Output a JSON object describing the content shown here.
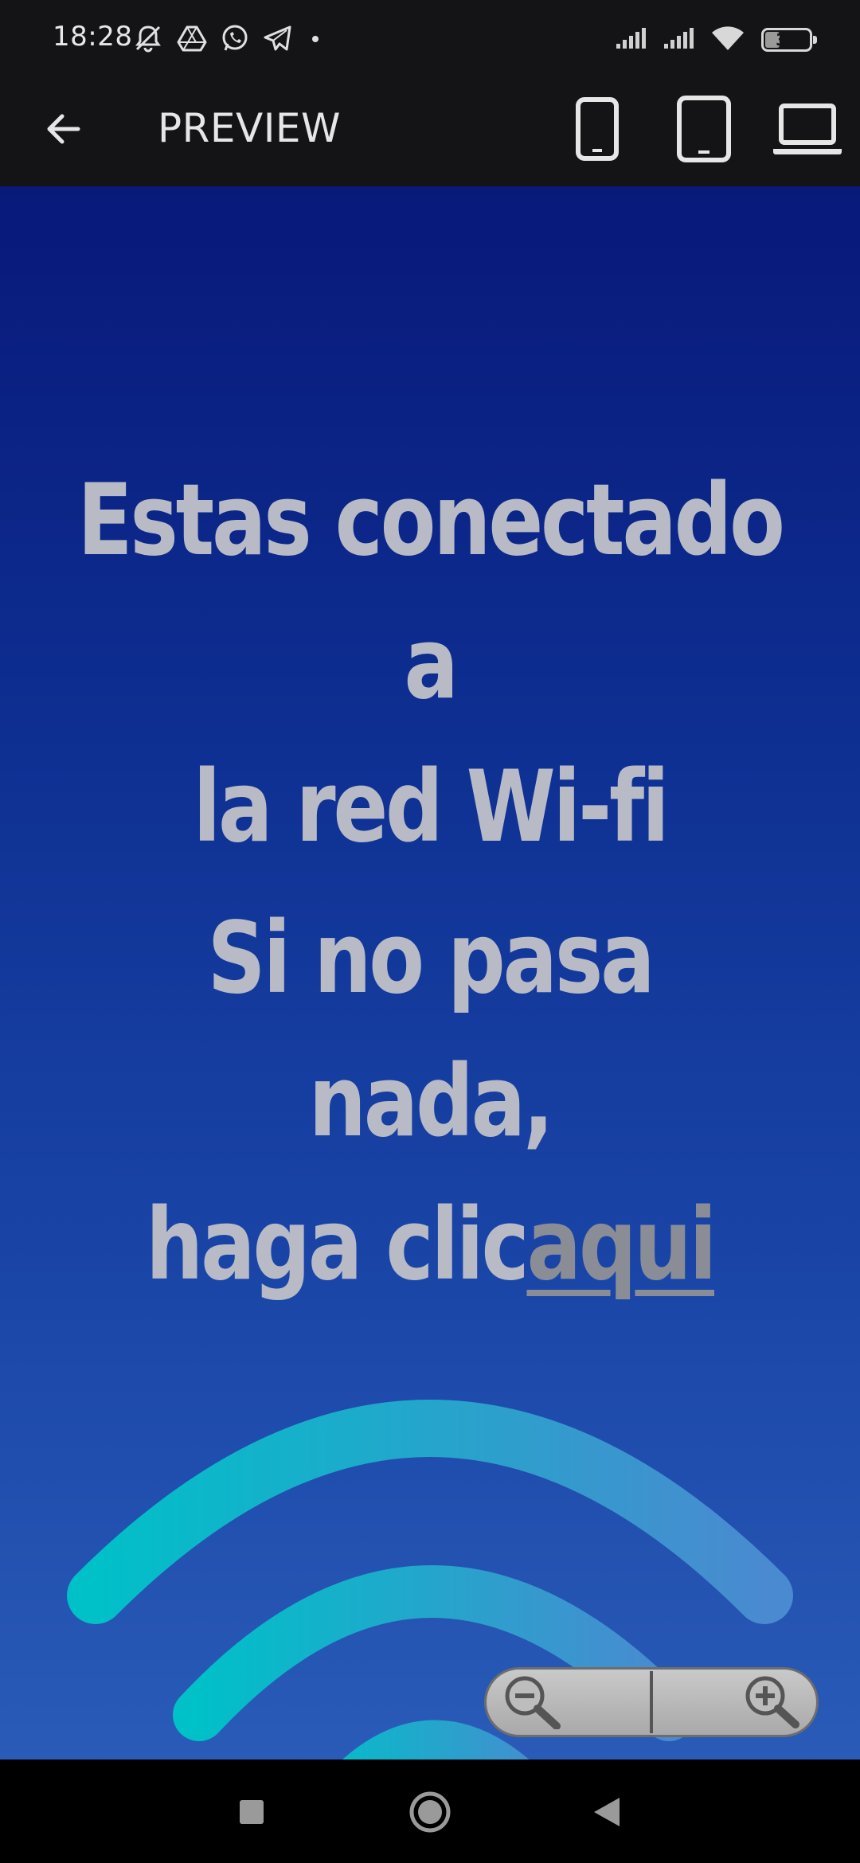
{
  "status_bar": {
    "time": "18:28",
    "battery": "38",
    "battery_level_percent": 38,
    "left_icons": [
      "silent-icon",
      "drive-icon",
      "whatsapp-icon",
      "telegram-icon",
      "dot-icon"
    ],
    "right_icons": [
      "signal-icon",
      "signal-icon",
      "wifi-icon",
      "battery-icon"
    ]
  },
  "app_bar": {
    "title": "PREVIEW",
    "back_icon": "arrow-back-icon",
    "device_buttons": [
      "phone-icon",
      "tablet-icon",
      "laptop-icon"
    ]
  },
  "preview": {
    "headline_1_line_1": "Estas conectado a",
    "headline_1_line_2": "la red Wi-fi",
    "headline_2_line_1": "Si no pasa nada,",
    "headline_2_line_2_prefix": "haga clic",
    "link_text": "aqui",
    "colors": {
      "background_top": "#08197a",
      "background_bottom": "#2a5bb8",
      "text": "#b8bbc6",
      "link": "#8a8d96",
      "wifi_start": "#00c0c8",
      "wifi_end": "#4a8ad0"
    }
  },
  "zoom": {
    "zoom_out_icon": "zoom-out-icon",
    "zoom_in_icon": "zoom-in-icon"
  },
  "nav_bar": {
    "icons": [
      "recents-icon",
      "home-icon",
      "back-icon"
    ]
  }
}
